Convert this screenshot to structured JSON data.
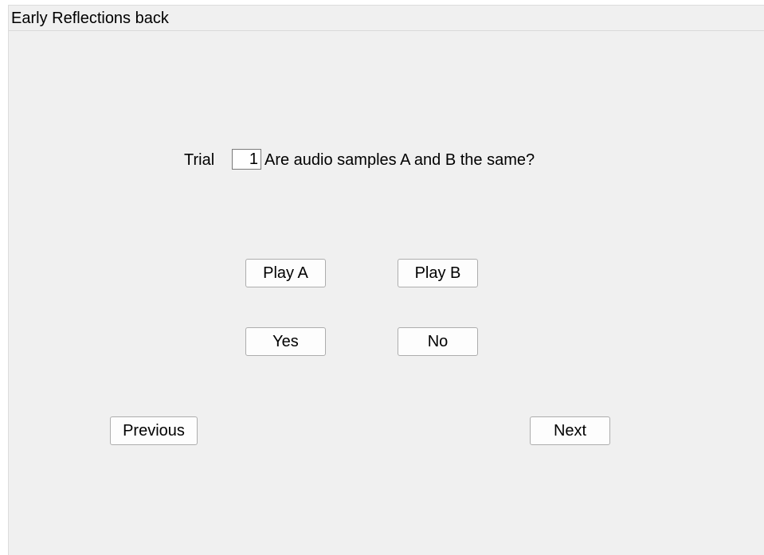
{
  "window": {
    "title": "Early Reflections back"
  },
  "question": {
    "trial_label": "Trial",
    "trial_value": "1",
    "text": "Are audio samples A and B the same?"
  },
  "playback": {
    "play_a_label": "Play A",
    "play_b_label": "Play B"
  },
  "answers": {
    "yes_label": "Yes",
    "no_label": "No"
  },
  "navigation": {
    "previous_label": "Previous",
    "next_label": "Next"
  }
}
